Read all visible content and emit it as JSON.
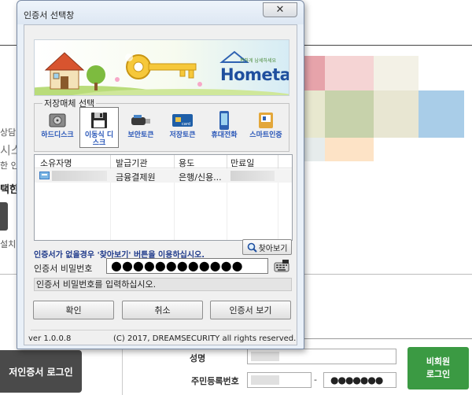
{
  "background": {
    "text_fragments": [
      "상담 예",
      "시스",
      "한 인터",
      "택한",
      "설치"
    ],
    "login_button_label": "저인증서 로그인",
    "form": {
      "name_label": "성명",
      "rrn_label": "주민등록번호",
      "rrn_separator": "-",
      "rrn_back_mask": "●●●●●●●"
    },
    "guest_login_button": {
      "line1": "비회원",
      "line2": "로그인"
    }
  },
  "dialog": {
    "title": "인증서 선택창",
    "close_symbol": "✕",
    "banner": {
      "logo_tagline": "편하게 납세하세요",
      "logo_text": "Hometax."
    },
    "storage_group_label": "저장매체 선택",
    "media": [
      {
        "label": "하드디스크",
        "icon": "hard-disk-icon"
      },
      {
        "label": "이동식 디스크",
        "icon": "floppy-disk-icon",
        "selected": true
      },
      {
        "label": "보안토큰",
        "icon": "security-token-icon"
      },
      {
        "label": "저장토큰",
        "icon": "smart-card-icon"
      },
      {
        "label": "휴대전화",
        "icon": "mobile-phone-icon"
      },
      {
        "label": "스마트인증",
        "icon": "smart-auth-icon"
      }
    ],
    "table": {
      "columns": [
        "소유자명",
        "발급기관",
        "용도",
        "만료일"
      ],
      "rows": [
        {
          "issuer": "금융결제원",
          "purpose": "은행/신용..."
        }
      ]
    },
    "hint_text": "인증서가 없을경우 '찾아보기' 버튼을 이용하십시오.",
    "find_button_label": "찾아보기",
    "password_label": "인증서 비밀번호",
    "password_mask": "●●●●●●●●●●●●",
    "status_text": "인증서 비밀번호를 입력하십시오.",
    "buttons": {
      "ok": "확인",
      "cancel": "취소",
      "view": "인증서 보기"
    },
    "version": "ver 1.0.0.8",
    "copyright": "(C) 2017, DREAMSECURITY all rights reserved."
  },
  "colors": {
    "dialog_frame": "#7a8ba5",
    "media_label": "#2a57b8",
    "hint_text": "#1f3a8a",
    "guest_button": "#3b9a43",
    "login_button": "#4a4a4a"
  }
}
